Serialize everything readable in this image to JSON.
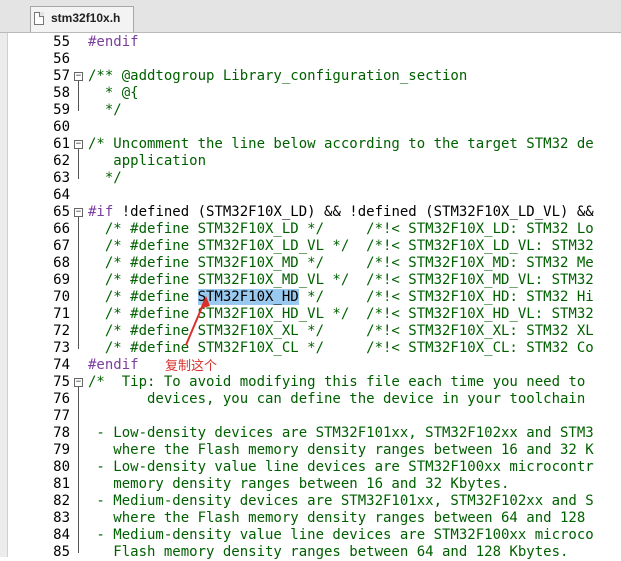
{
  "tab": {
    "title": "stm32f10x.h",
    "icon": "file-icon"
  },
  "annotation": "复制这个",
  "lines": [
    {
      "n": "55",
      "segs": [
        {
          "t": "#endif",
          "c": "pp"
        }
      ]
    },
    {
      "n": "56",
      "segs": []
    },
    {
      "n": "57",
      "segs": [
        {
          "t": "/** @addtogroup Library_configuration_section",
          "c": ""
        }
      ],
      "fold": "-"
    },
    {
      "n": "58",
      "segs": [
        {
          "t": "  * @{",
          "c": ""
        }
      ]
    },
    {
      "n": "59",
      "segs": [
        {
          "t": "  */",
          "c": ""
        }
      ]
    },
    {
      "n": "60",
      "segs": []
    },
    {
      "n": "61",
      "segs": [
        {
          "t": "/* Uncomment the line below according to the target STM32 de",
          "c": ""
        }
      ],
      "fold": "-"
    },
    {
      "n": "62",
      "segs": [
        {
          "t": "   application",
          "c": ""
        }
      ]
    },
    {
      "n": "63",
      "segs": [
        {
          "t": "  */",
          "c": ""
        }
      ]
    },
    {
      "n": "64",
      "segs": []
    },
    {
      "n": "65",
      "segs": [
        {
          "t": "#if",
          "c": "pp"
        },
        {
          "t": " !defined (STM32F10X_LD) && !defined (STM32F10X_LD_VL) &&",
          "c": "plain"
        }
      ],
      "fold": "-"
    },
    {
      "n": "66",
      "segs": [
        {
          "t": "  /* #define STM32F10X_LD */     /*!< STM32F10X_LD: STM32 Lo",
          "c": ""
        }
      ]
    },
    {
      "n": "67",
      "segs": [
        {
          "t": "  /* #define STM32F10X_LD_VL */  /*!< STM32F10X_LD_VL: STM32",
          "c": ""
        }
      ]
    },
    {
      "n": "68",
      "segs": [
        {
          "t": "  /* #define STM32F10X_MD */     /*!< STM32F10X_MD: STM32 Me",
          "c": ""
        }
      ]
    },
    {
      "n": "69",
      "segs": [
        {
          "t": "  /* #define STM32F10X_MD_VL */  /*!< STM32F10X_MD_VL: STM32",
          "c": ""
        }
      ]
    },
    {
      "n": "70",
      "segs": [
        {
          "t": "  /* #define ",
          "c": ""
        },
        {
          "t": "STM32F10X_HD",
          "c": "hl"
        },
        {
          "t": " */     /*!< STM32F10X_HD: STM32 Hi",
          "c": ""
        }
      ]
    },
    {
      "n": "71",
      "segs": [
        {
          "t": "  /* #define STM32F10X_HD_VL */  /*!< STM32F10X_HD_VL: STM32",
          "c": ""
        }
      ]
    },
    {
      "n": "72",
      "segs": [
        {
          "t": "  /* #define STM32F10X_XL */     /*!< STM32F10X_XL: STM32 XL",
          "c": ""
        }
      ]
    },
    {
      "n": "73",
      "segs": [
        {
          "t": "  /* #define STM32F10X_CL */     /*!< STM32F10X_CL: STM32 Co",
          "c": ""
        }
      ]
    },
    {
      "n": "74",
      "segs": [
        {
          "t": "#endif",
          "c": "pp"
        }
      ]
    },
    {
      "n": "75",
      "segs": [
        {
          "t": "/*  Tip: To avoid modifying this file each time you need to",
          "c": ""
        }
      ],
      "fold": "-"
    },
    {
      "n": "76",
      "segs": [
        {
          "t": "       devices, you can define the device in your toolchain",
          "c": ""
        }
      ]
    },
    {
      "n": "77",
      "segs": []
    },
    {
      "n": "78",
      "segs": [
        {
          "t": " - Low-density devices are STM32F101xx, STM32F102xx and STM3",
          "c": ""
        }
      ]
    },
    {
      "n": "79",
      "segs": [
        {
          "t": "   where the Flash memory density ranges between 16 and 32 K",
          "c": ""
        }
      ]
    },
    {
      "n": "80",
      "segs": [
        {
          "t": " - Low-density value line devices are STM32F100xx microcontr",
          "c": ""
        }
      ]
    },
    {
      "n": "81",
      "segs": [
        {
          "t": "   memory density ranges between 16 and 32 Kbytes.",
          "c": ""
        }
      ]
    },
    {
      "n": "82",
      "segs": [
        {
          "t": " - Medium-density devices are STM32F101xx, STM32F102xx and S",
          "c": ""
        }
      ]
    },
    {
      "n": "83",
      "segs": [
        {
          "t": "   where the Flash memory density ranges between 64 and 128",
          "c": ""
        }
      ]
    },
    {
      "n": "84",
      "segs": [
        {
          "t": " - Medium-density value line devices are STM32F100xx microco",
          "c": ""
        }
      ]
    },
    {
      "n": "85",
      "segs": [
        {
          "t": "   Flash memory density ranges between 64 and 128 Kbytes.",
          "c": ""
        }
      ]
    }
  ]
}
